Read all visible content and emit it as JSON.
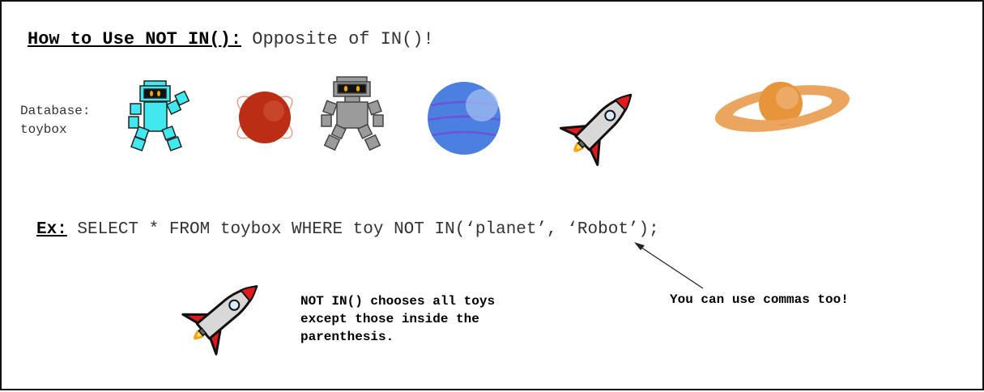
{
  "title": {
    "heading": "How to Use NOT IN():",
    "subtitle": " Opposite of IN()!"
  },
  "database": {
    "label": "Database:",
    "name": "toybox"
  },
  "toys": [
    {
      "icon": "robot-icon",
      "color": "#41e8f0"
    },
    {
      "icon": "planet-icon",
      "color": "#bb2d14"
    },
    {
      "icon": "robot-icon",
      "color": "#9b9b9b"
    },
    {
      "icon": "planet-icon",
      "color": "#4b7fe0"
    },
    {
      "icon": "rocket-icon",
      "color": "#e11b1b"
    },
    {
      "icon": "ringed-planet-icon",
      "color": "#e8943a"
    }
  ],
  "example": {
    "label": "Ex:",
    "query": " SELECT * FROM toybox WHERE toy NOT IN(‘planet’, ‘Robot’);"
  },
  "notes": {
    "explanation": "NOT IN() chooses all toys except those inside the parenthesis.",
    "commas": "You can use commas too!"
  },
  "illustration": {
    "icon": "rocket-icon"
  }
}
